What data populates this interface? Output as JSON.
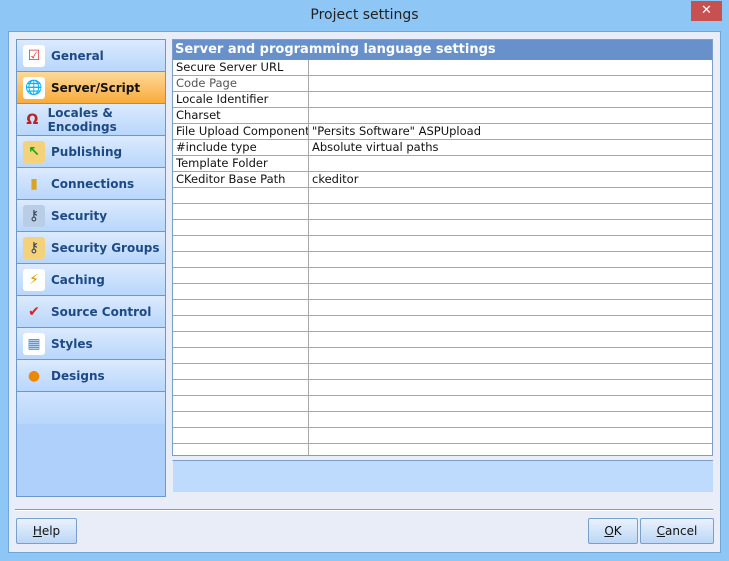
{
  "window": {
    "title": "Project settings",
    "close_icon": "close-icon"
  },
  "sidebar": {
    "items": [
      {
        "label": "General",
        "icon": "checklist-icon",
        "selected": false
      },
      {
        "label": "Server/Script",
        "icon": "server-globe-icon",
        "selected": true
      },
      {
        "label": "Locales & Encodings",
        "icon": "locale-letters-icon",
        "selected": false
      },
      {
        "label": "Publishing",
        "icon": "publish-folder-icon",
        "selected": false
      },
      {
        "label": "Connections",
        "icon": "database-icon",
        "selected": false
      },
      {
        "label": "Security",
        "icon": "key-folder-icon",
        "selected": false
      },
      {
        "label": "Security Groups",
        "icon": "group-key-icon",
        "selected": false
      },
      {
        "label": "Caching",
        "icon": "cache-table-icon",
        "selected": false
      },
      {
        "label": "Source Control",
        "icon": "lock-check-icon",
        "selected": false
      },
      {
        "label": "Styles",
        "icon": "styles-palette-icon",
        "selected": false
      },
      {
        "label": "Designs",
        "icon": "designs-palette-icon",
        "selected": false
      }
    ]
  },
  "grid": {
    "header": "Server and programming language settings",
    "rows": [
      {
        "key": "Secure Server URL",
        "value": ""
      },
      {
        "key": "Code Page",
        "value": ""
      },
      {
        "key": "Locale Identifier",
        "value": ""
      },
      {
        "key": "Charset",
        "value": ""
      },
      {
        "key": "File Upload Component",
        "value": "\"Persits Software\" ASPUpload"
      },
      {
        "key": "#include type",
        "value": "Absolute virtual paths"
      },
      {
        "key": "Template Folder",
        "value": ""
      },
      {
        "key": "CKeditor Base Path",
        "value": "ckeditor"
      }
    ]
  },
  "buttons": {
    "help": {
      "access": "H",
      "rest": "elp"
    },
    "ok": {
      "access": "O",
      "rest": "K"
    },
    "cancel": {
      "access": "C",
      "rest": "ancel"
    }
  },
  "colors": {
    "accent": "#6890cb",
    "selected": "#f9ab3a",
    "close": "#c75050"
  }
}
